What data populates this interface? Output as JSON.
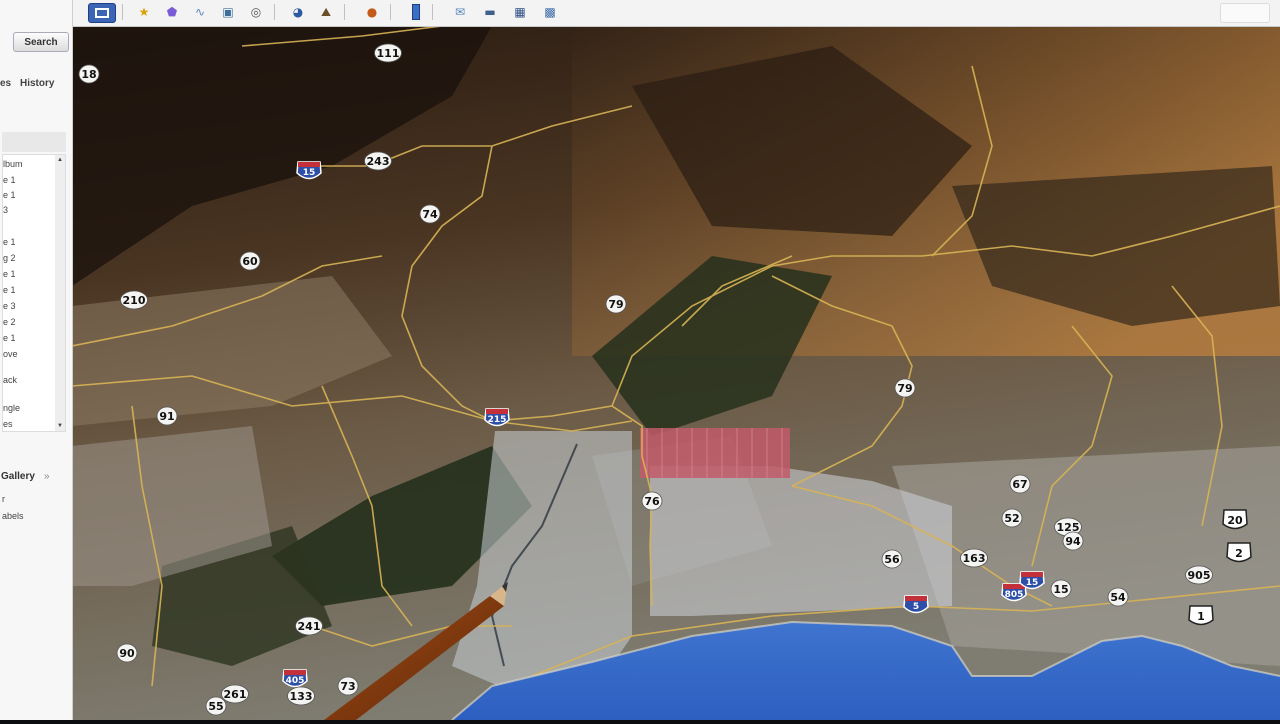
{
  "sidebar": {
    "search_label": "Search",
    "tabs": [
      "es",
      "History"
    ],
    "layer_fragments": [
      "lbum",
      "e 1",
      "e 1",
      "3",
      "e 1",
      "g 2",
      "e 1",
      "e 1",
      "e 3",
      "e 2",
      "e 1",
      "ove",
      "ack",
      "ngle",
      "es"
    ],
    "gallery_label": "Gallery",
    "gallery_arrows": "»",
    "bottom_fragments": [
      "r",
      "abels"
    ]
  },
  "map": {
    "highway_shields": [
      {
        "type": "state",
        "label": "111"
      },
      {
        "type": "state",
        "label": "18"
      },
      {
        "type": "interstate",
        "label": "15"
      },
      {
        "type": "state",
        "label": "243"
      },
      {
        "type": "state",
        "label": "74"
      },
      {
        "type": "state",
        "label": "60"
      },
      {
        "type": "state",
        "label": "210"
      },
      {
        "type": "state",
        "label": "79"
      },
      {
        "type": "state",
        "label": "91"
      },
      {
        "type": "interstate",
        "label": "215"
      },
      {
        "type": "state",
        "label": "79"
      },
      {
        "type": "state",
        "label": "76"
      },
      {
        "type": "state",
        "label": "67"
      },
      {
        "type": "state",
        "label": "52"
      },
      {
        "type": "state",
        "label": "125"
      },
      {
        "type": "state",
        "label": "94"
      },
      {
        "type": "state",
        "label": "56"
      },
      {
        "type": "state",
        "label": "163"
      },
      {
        "type": "interstate",
        "label": "5"
      },
      {
        "type": "interstate",
        "label": "805"
      },
      {
        "type": "interstate",
        "label": "15"
      },
      {
        "type": "state",
        "label": "15"
      },
      {
        "type": "state",
        "label": "54"
      },
      {
        "type": "state",
        "label": "905"
      },
      {
        "type": "us",
        "label": "20"
      },
      {
        "type": "us",
        "label": "2"
      },
      {
        "type": "us",
        "label": "1"
      },
      {
        "type": "state",
        "label": "241"
      },
      {
        "type": "interstate",
        "label": "405"
      },
      {
        "type": "state",
        "label": "133"
      },
      {
        "type": "state",
        "label": "90"
      },
      {
        "type": "state",
        "label": "261"
      },
      {
        "type": "state",
        "label": "55"
      },
      {
        "type": "state",
        "label": "73"
      }
    ]
  }
}
